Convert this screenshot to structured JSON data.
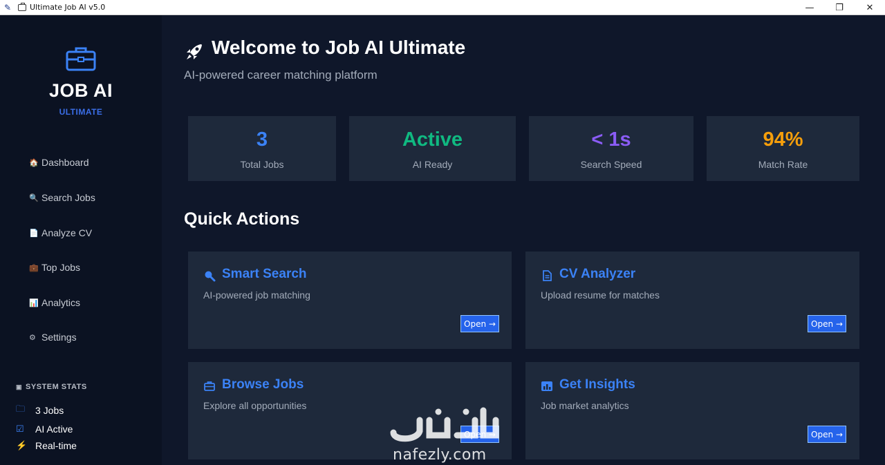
{
  "window": {
    "title": "Ultimate Job AI v5.0",
    "controls": {
      "minimize": "—",
      "maximize": "❐",
      "close": "✕"
    }
  },
  "sidebar": {
    "brand": "JOB AI",
    "brand_sub": "ULTIMATE",
    "items": [
      {
        "icon": "home-icon",
        "glyph": "🏠",
        "label": "Dashboard"
      },
      {
        "icon": "search-icon",
        "glyph": "🔍",
        "label": "Search Jobs"
      },
      {
        "icon": "document-icon",
        "glyph": "📄",
        "label": "Analyze CV"
      },
      {
        "icon": "briefcase-icon",
        "glyph": "💼",
        "label": "Top Jobs"
      },
      {
        "icon": "bar-chart-icon",
        "glyph": "📊",
        "label": "Analytics"
      },
      {
        "icon": "gear-icon",
        "glyph": "⚙",
        "label": "Settings"
      }
    ],
    "system_stats": {
      "title": "SYSTEM STATS",
      "rows": [
        {
          "icon": "folder-icon",
          "glyph": "🗀",
          "label": "3 Jobs"
        },
        {
          "icon": "checkbox-icon",
          "glyph": "☑",
          "label": "AI Active"
        },
        {
          "icon": "lightning-icon",
          "glyph": "⚡",
          "label": "Real-time"
        }
      ]
    }
  },
  "header": {
    "title": "Welcome to Job AI Ultimate",
    "subtitle": "AI-powered career matching platform"
  },
  "stats": [
    {
      "value": "3",
      "label": "Total Jobs",
      "color": "#3b82f6"
    },
    {
      "value": "Active",
      "label": "AI Ready",
      "color": "#10b981"
    },
    {
      "value": "< 1s",
      "label": "Search Speed",
      "color": "#8b5cf6"
    },
    {
      "value": "94%",
      "label": "Match Rate",
      "color": "#f59e0b"
    }
  ],
  "quick_actions": {
    "title": "Quick Actions",
    "items": [
      {
        "icon": "search-icon",
        "title": "Smart Search",
        "description": "AI-powered job matching",
        "button": "Open →"
      },
      {
        "icon": "document-icon",
        "title": "CV Analyzer",
        "description": "Upload resume for matches",
        "button": "Open →"
      },
      {
        "icon": "briefcase-icon",
        "title": "Browse Jobs",
        "description": "Explore all opportunities",
        "button": "Open →"
      },
      {
        "icon": "chart-icon",
        "title": "Get Insights",
        "description": "Job market analytics",
        "button": "Open →"
      }
    ]
  },
  "watermark": {
    "text": "nafezly.com"
  },
  "colors": {
    "accent": "#3b82f6",
    "background": "#0f172a",
    "sidebar": "#0b1222",
    "card": "#1e293b"
  }
}
